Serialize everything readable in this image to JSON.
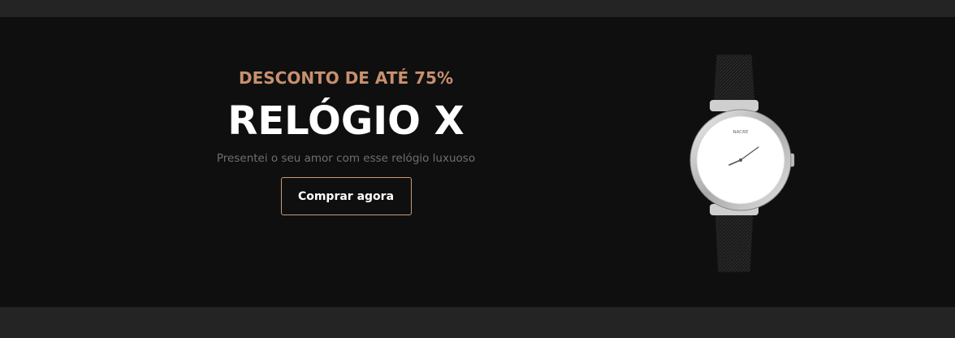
{
  "hero": {
    "discount": "DESCONTO DE ATÉ 75%",
    "title": "RELÓGIO X",
    "subtitle": "Presentei o seu amor com esse relógio luxuoso",
    "cta_label": "Comprar agora"
  },
  "product": {
    "brand": "NACRE",
    "image_icon": "wristwatch-image"
  },
  "colors": {
    "background": "#0f0f0f",
    "bars": "#242424",
    "accent": "#c8906e",
    "cta_border": "#c89b78",
    "title": "#ffffff",
    "subtitle": "#6f6f6f"
  }
}
